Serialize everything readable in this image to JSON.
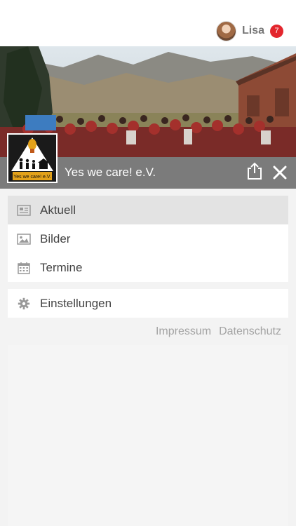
{
  "header": {
    "user_name": "Lisa",
    "notification_count": "7",
    "badge_color": "#e3262d"
  },
  "organization": {
    "name": "Yes we care! e.V.",
    "logo_text": "Yes we care!",
    "logo_small": "e.V."
  },
  "menu": {
    "primary": [
      {
        "label": "Aktuell",
        "icon": "newspaper-icon",
        "active": true
      },
      {
        "label": "Bilder",
        "icon": "image-icon",
        "active": false
      },
      {
        "label": "Termine",
        "icon": "calendar-icon",
        "active": false
      }
    ],
    "secondary": [
      {
        "label": "Einstellungen",
        "icon": "gear-icon",
        "active": false
      }
    ]
  },
  "footer": {
    "impressum": "Impressum",
    "datenschutz": "Datenschutz"
  },
  "colors": {
    "title_bar": "#7b7b7b",
    "active_item": "#e3e3e3",
    "background": "#f3f3f3"
  }
}
